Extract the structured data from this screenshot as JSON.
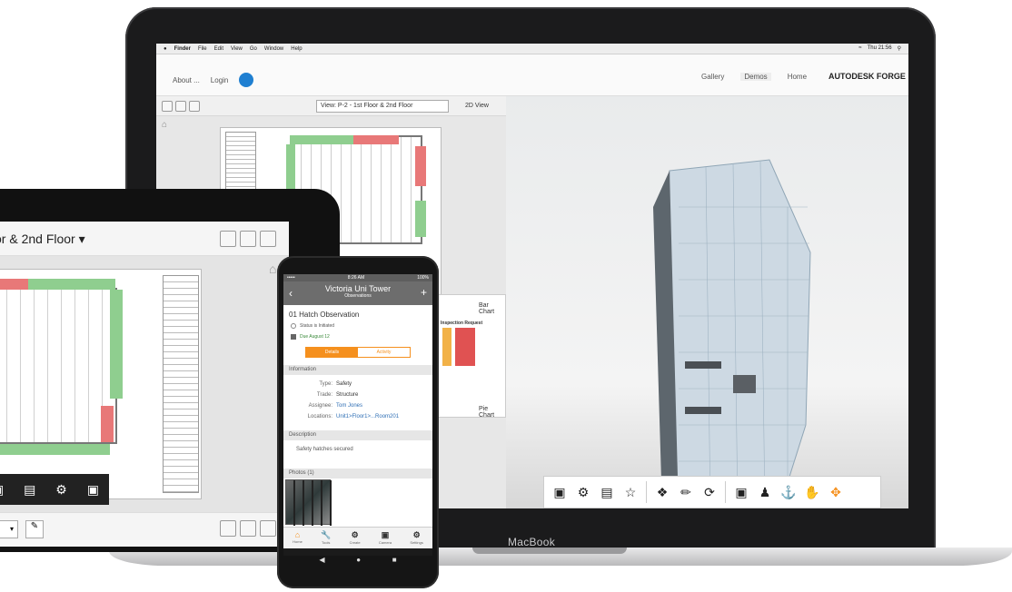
{
  "laptop": {
    "brand": "MacBook",
    "menubar": {
      "items": [
        "Finder",
        "File",
        "Edit",
        "View",
        "Go",
        "Window",
        "Help"
      ],
      "status": [
        "Thu 21:56"
      ]
    },
    "forge": {
      "logo": "AUTODESK FORGE",
      "nav": [
        "Home",
        "Demos",
        "Gallery"
      ],
      "right": [
        "Login",
        "About ..."
      ]
    },
    "viewer2d": {
      "mode": "2D View",
      "view_select": "View: P-2 - 1st Floor & 2nd Floor",
      "bar_chart_label": "Bar Chart",
      "pie_chart_label": "Pie Chart",
      "chart_title": "Inspection Request"
    },
    "toolbar3d": {
      "icons": [
        "section-icon",
        "settings-icon",
        "properties-icon",
        "model-browser-icon",
        "explode-icon",
        "measure-icon",
        "orbit-icon",
        "camera-icon",
        "person-icon",
        "anchor-icon",
        "pan-icon",
        "fit-icon"
      ]
    }
  },
  "tablet": {
    "title": "or & 2nd Floor"
  },
  "phone": {
    "status_time": "8:26 AM",
    "status_carrier": "•••••",
    "status_battery": "100%",
    "title": "Victoria Uni Tower",
    "subtitle": "Observations",
    "observation_title": "01 Hatch Observation",
    "status_text": "Status is Initiated",
    "due_text": "Due August 12",
    "tab_details": "Details",
    "tab_activity": "Activity",
    "section_information": "Information",
    "fields": [
      {
        "k": "Type:",
        "v": "Safety",
        "link": false
      },
      {
        "k": "Trade:",
        "v": "Structure",
        "link": false
      },
      {
        "k": "Assignee:",
        "v": "Tom Jones",
        "link": true
      },
      {
        "k": "Locations:",
        "v": "Unit1>Floor1>...Room201",
        "link": true
      }
    ],
    "section_description": "Description",
    "description": "Safety hatches secured",
    "section_photos": "Photos (1)",
    "tabbar": [
      "Home",
      "Tools",
      "Create",
      "Camera",
      "Settings"
    ]
  },
  "colors": {
    "accent": "#f5901e",
    "chart_red": "#e05252",
    "chart_orange": "#f2b248",
    "plan_green": "#8fce8f",
    "plan_red": "#e87878"
  }
}
